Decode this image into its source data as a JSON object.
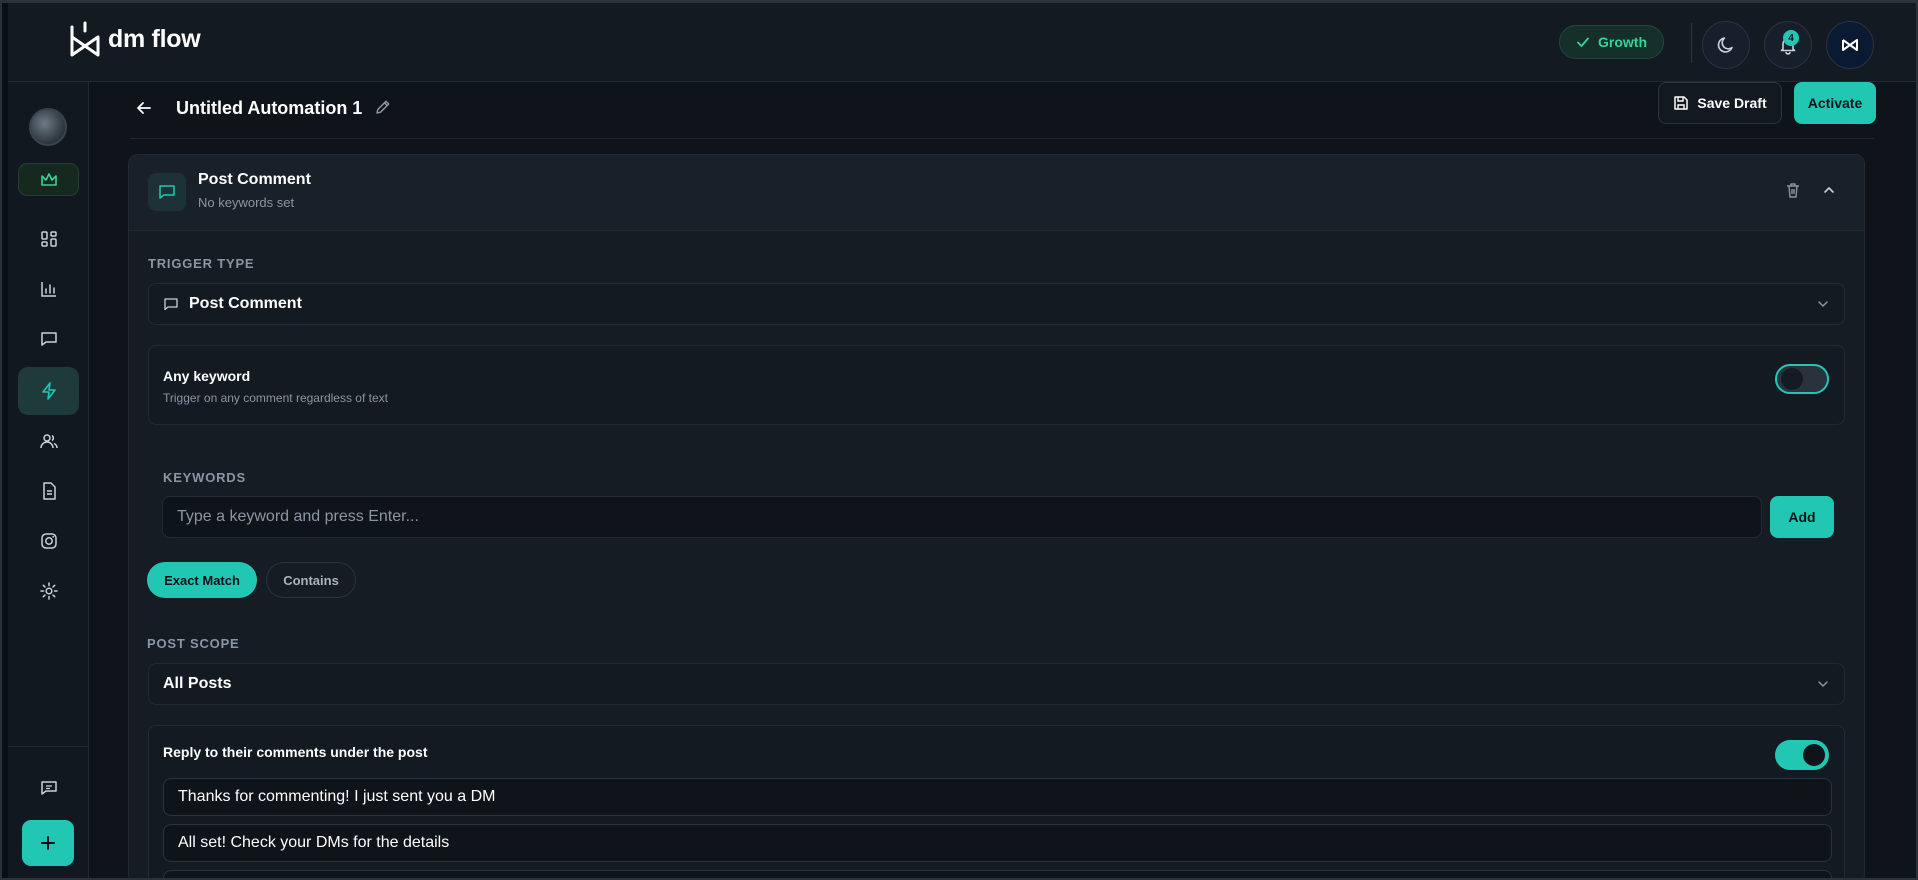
{
  "app": {
    "brand_name": "dm flow",
    "plan_badge": "Growth",
    "notification_count": "4"
  },
  "colors": {
    "accent": "#22c7b4",
    "plan_green": "#37d39a",
    "background": "#0f141a",
    "panel": "#151c24"
  },
  "sidebar": {
    "items": [
      {
        "icon": "dashboard-icon",
        "active": false
      },
      {
        "icon": "bar-chart-icon",
        "active": false
      },
      {
        "icon": "message-square-icon",
        "active": false
      },
      {
        "icon": "lightning-icon",
        "active": true
      },
      {
        "icon": "users-icon",
        "active": false
      },
      {
        "icon": "document-icon",
        "active": false
      },
      {
        "icon": "instagram-icon",
        "active": false
      },
      {
        "icon": "settings-icon",
        "active": false
      }
    ]
  },
  "page": {
    "title": "Untitled Automation 1",
    "save_draft_label": "Save Draft",
    "activate_label": "Activate"
  },
  "trigger": {
    "title": "Post Comment",
    "subtitle": "No keywords set",
    "trigger_type_label": "TRIGGER TYPE",
    "trigger_type_value": "Post Comment",
    "any_keyword_title": "Any keyword",
    "any_keyword_desc": "Trigger on any comment regardless of text",
    "any_keyword_enabled": false,
    "keywords_label": "KEYWORDS",
    "keyword_placeholder": "Type a keyword and press Enter...",
    "add_label": "Add",
    "match_modes": [
      "Exact Match",
      "Contains"
    ],
    "selected_match_mode": "Exact Match",
    "post_scope_label": "POST SCOPE",
    "post_scope_value": "All Posts",
    "reply_title": "Reply to their comments under the post",
    "reply_enabled": true,
    "replies": [
      "Thanks for commenting! I just sent you a DM",
      "All set! Check your DMs for the details"
    ]
  }
}
